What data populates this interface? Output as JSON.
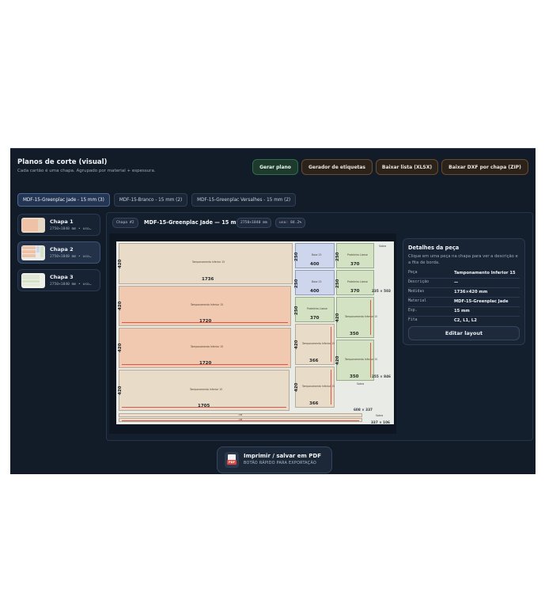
{
  "header": {
    "title": "Planos de corte (visual)",
    "subtitle": "Cada cartão é uma chapa. Agrupado por material + espessura."
  },
  "actions": {
    "gerar": "Gerar plano",
    "etiquetas": "Gerador de etiquetas",
    "xlsx": "Baixar lista (XLSX)",
    "dxf": "Baixar DXF por chapa (ZIP)"
  },
  "tabs": [
    {
      "label": "MDF-15-Greenplac Jade - 15 mm (3)"
    },
    {
      "label": "MDF-15-Branco - 15 mm (2)"
    },
    {
      "label": "MDF-15-Greenplac Versalhes - 15 mm (2)"
    }
  ],
  "sheets": [
    {
      "name": "Chapa 1",
      "meta": "2750×1840 mm • uso…"
    },
    {
      "name": "Chapa 2",
      "meta": "2750×1840 mm • uso…"
    },
    {
      "name": "Chapa 3",
      "meta": "2750×1840 mm • uso…"
    }
  ],
  "sheet_header": {
    "chip": "Chapa #2",
    "title": "MDF-15-Greenplac Jade — 15 mm",
    "size": "2750×1840 mm",
    "uso": "uso: 84.2%"
  },
  "pieces": {
    "p1": {
      "name": "Tamponamento Inferior 15",
      "w": "1736",
      "h": "420"
    },
    "p2": {
      "name": "Tamponamento Inferior 15",
      "w": "1720",
      "h": "420"
    },
    "p3": {
      "name": "Tamponamento Inferior 15",
      "w": "1720",
      "h": "420"
    },
    "p4": {
      "name": "Tamponamento Inferior 15",
      "w": "1705",
      "h": "420"
    },
    "b1": {
      "name": "Base 15",
      "w": "400",
      "h": "250"
    },
    "b2": {
      "name": "Base 15",
      "w": "400",
      "h": "250"
    },
    "t1": {
      "name": "Prateleira Lixeue",
      "w": "370",
      "h": "250"
    },
    "t2": {
      "name": "Prateleira Lixeue",
      "w": "370",
      "h": "250"
    },
    "t3": {
      "name": "Prateleira Lixeue",
      "w": "370",
      "h": "250"
    },
    "s1": {
      "name": "Tamponamento Inferior 15",
      "w": "350",
      "h": "420"
    },
    "s2": {
      "name": "Tamponamento Inferior 15",
      "w": "350",
      "h": "420"
    },
    "m1": {
      "name": "Tamponamento Inferior 15",
      "w": "366",
      "h": "420"
    },
    "m2": {
      "name": "Tamponamento Inferior 15",
      "w": "366",
      "h": "420"
    }
  },
  "scraps": {
    "r1_label": "Sobra",
    "r1_dim": "235 × 503",
    "r2_label": "Sobra",
    "r2_dim": "255 × 846",
    "r3_dim": "608 × 337",
    "r4_label": "Sobra",
    "r4_dim": "337 × 106",
    "strip1": "≈88",
    "strip2": "≈88"
  },
  "detail": {
    "title": "Detalhes da peça",
    "hint": "Clique em uma peça na chapa para ver a descrição e a fita de borda.",
    "rows": [
      {
        "k": "Peça",
        "v": "Tamponamento Inferior 15"
      },
      {
        "k": "Descrição",
        "v": "—"
      },
      {
        "k": "Medidas",
        "v": "1736×420 mm"
      },
      {
        "k": "Material",
        "v": "MDF-15-Greenplac Jade"
      },
      {
        "k": "Esp.",
        "v": "15 mm"
      },
      {
        "k": "Fita",
        "v": "C2, L1, L2"
      }
    ],
    "edit": "Editar layout"
  },
  "print": {
    "title": "Imprimir / salvar em PDF",
    "subtitle": "BOTÃO RÁPIDO PARA EXPORTAÇÃO",
    "badge": "PDF"
  },
  "colors": {
    "accent_green": "#2f6e4c",
    "piece_salmon": "#f0c9b0",
    "piece_beige": "#e8dcc8",
    "piece_blue": "#cdd6ec",
    "piece_green": "#d3e2c3",
    "edge_band": "#e0554a"
  }
}
